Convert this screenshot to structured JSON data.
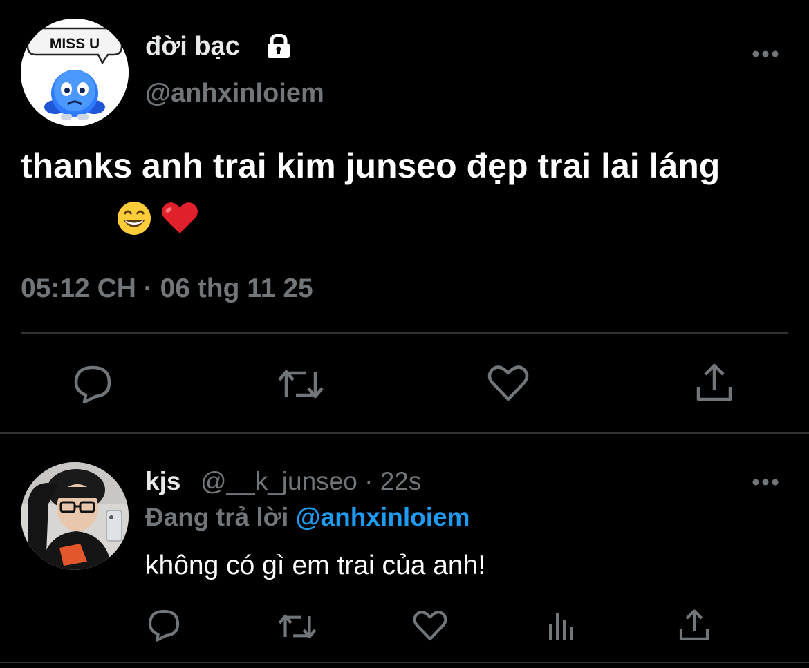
{
  "colors": {
    "background": "#000000",
    "text_primary": "#ffffff",
    "text_secondary": "#71767b",
    "accent_link": "#1d9bf0",
    "divider": "#2f3336",
    "heart_red": "#e0202a"
  },
  "main_tweet": {
    "avatar": {
      "icon": "sad-blue-emoji-avatar",
      "bubble_text": "MISS U"
    },
    "display_name": "đời bạc",
    "lock_icon": "lock-icon",
    "handle": "@anhxinloiem",
    "more_icon": "more-horizontal-icon",
    "text": "thanks anh trai kim junseo đẹp trai lai láng",
    "emojis": [
      "grinning-face-emoji",
      "red-heart-emoji"
    ],
    "timestamp": "05:12 CH · 06 thg 11 25",
    "actions": [
      "reply-icon",
      "retweet-icon",
      "like-icon",
      "share-icon"
    ]
  },
  "reply_tweet": {
    "avatar": {
      "icon": "user-photo-avatar"
    },
    "display_name": "kjs",
    "meta": "@__k_junseo · 22s",
    "more_icon": "more-horizontal-icon",
    "replying_to_label": "Đang trả lời",
    "replying_to_handle": "@anhxinloiem",
    "text": "không có gì em trai của anh!",
    "actions": [
      "reply-icon",
      "retweet-icon",
      "like-icon",
      "views-icon",
      "share-icon"
    ]
  }
}
